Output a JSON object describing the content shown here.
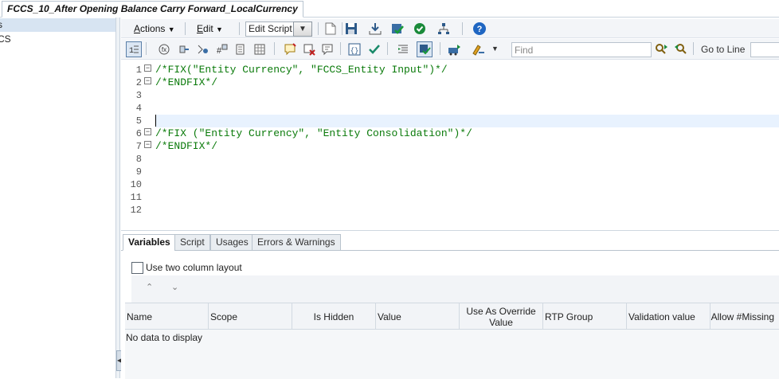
{
  "document_tab": {
    "title": "FCCS_10_After Opening Balance Carry Forward_LocalCurrency"
  },
  "navigator": {
    "items": [
      {
        "label": "s",
        "selected": true
      },
      {
        "label": "CS",
        "selected": false
      }
    ]
  },
  "toolbar": {
    "actions_label": "Actions",
    "actions_mnemonic": "A",
    "actions_rest": "ctions",
    "edit_label": "Edit",
    "edit_mnemonic": "E",
    "edit_rest": "dit",
    "edit_script_value": "Edit Script",
    "find_placeholder": "Find",
    "goto_label": "Go to Line"
  },
  "editor": {
    "lines": [
      {
        "num": "1",
        "text": "/*FIX(\"Entity Currency\", \"FCCS_Entity Input\")*/",
        "fold": true
      },
      {
        "num": "2",
        "text": "/*ENDFIX*/",
        "fold": true
      },
      {
        "num": "3",
        "text": "",
        "fold": false
      },
      {
        "num": "4",
        "text": "",
        "fold": false
      },
      {
        "num": "5",
        "text": "",
        "fold": false
      },
      {
        "num": "6",
        "text": "/*FIX (\"Entity Currency\", \"Entity Consolidation\")*/",
        "fold": true
      },
      {
        "num": "7",
        "text": "/*ENDFIX*/",
        "fold": true
      },
      {
        "num": "8",
        "text": "",
        "fold": false
      },
      {
        "num": "9",
        "text": "",
        "fold": false
      },
      {
        "num": "10",
        "text": "",
        "fold": false
      },
      {
        "num": "11",
        "text": "",
        "fold": false
      },
      {
        "num": "12",
        "text": "",
        "fold": false
      }
    ],
    "code_color": "#0a7a0a"
  },
  "bottom_panel": {
    "tabs": [
      {
        "label": "Variables",
        "active": true
      },
      {
        "label": "Script",
        "active": false
      },
      {
        "label": "Usages",
        "active": false
      },
      {
        "label": "Errors & Warnings",
        "active": false
      }
    ],
    "two_column_label": "Use two column layout",
    "columns": [
      {
        "label": "Name"
      },
      {
        "label": "Scope"
      },
      {
        "label": "Is Hidden"
      },
      {
        "label": "Value"
      },
      {
        "label": "Use As Override Value"
      },
      {
        "label": "RTP Group"
      },
      {
        "label": "Validation value"
      },
      {
        "label": "Allow #Missing"
      }
    ],
    "empty_message": "No data to display"
  }
}
